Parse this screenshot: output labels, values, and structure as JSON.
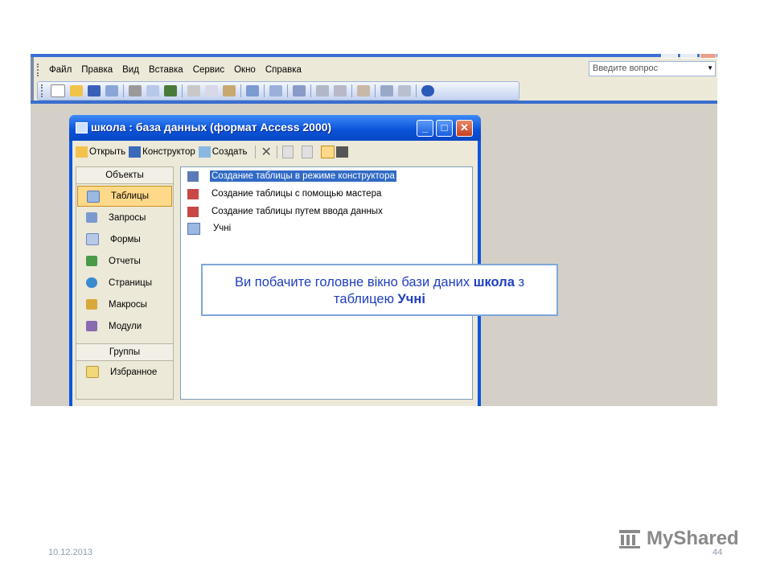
{
  "menu": {
    "items": [
      "Файл",
      "Правка",
      "Вид",
      "Вставка",
      "Сервис",
      "Окно",
      "Справка"
    ],
    "ask_placeholder": "Введите вопрос"
  },
  "db_window": {
    "title": "школа : база данных (формат Access 2000)",
    "toolbar": {
      "open": "Открыть",
      "constructor": "Конструктор",
      "create": "Создать"
    },
    "objects_header": "Объекты",
    "objects": [
      "Таблицы",
      "Запросы",
      "Формы",
      "Отчеты",
      "Страницы",
      "Макросы",
      "Модули"
    ],
    "groups_header": "Группы",
    "groups": [
      "Избранное"
    ],
    "files": [
      "Создание таблицы в режиме конструктора",
      "Создание таблицы с помощью мастера",
      "Создание таблицы путем ввода данных",
      "Учні"
    ]
  },
  "callout": {
    "line1_pre": "Ви побачите головне вікно бази даних ",
    "line1_bold": "школа",
    "line1_post": " з",
    "line2_pre": "таблицею ",
    "line2_bold": "Учні"
  },
  "footer": {
    "date": "10.12.2013",
    "page": "44",
    "logo": "MyShared"
  },
  "colors": {
    "title_blue": "#0a51d8",
    "selection": "#316ac5",
    "callout_text": "#1f3fbf"
  }
}
